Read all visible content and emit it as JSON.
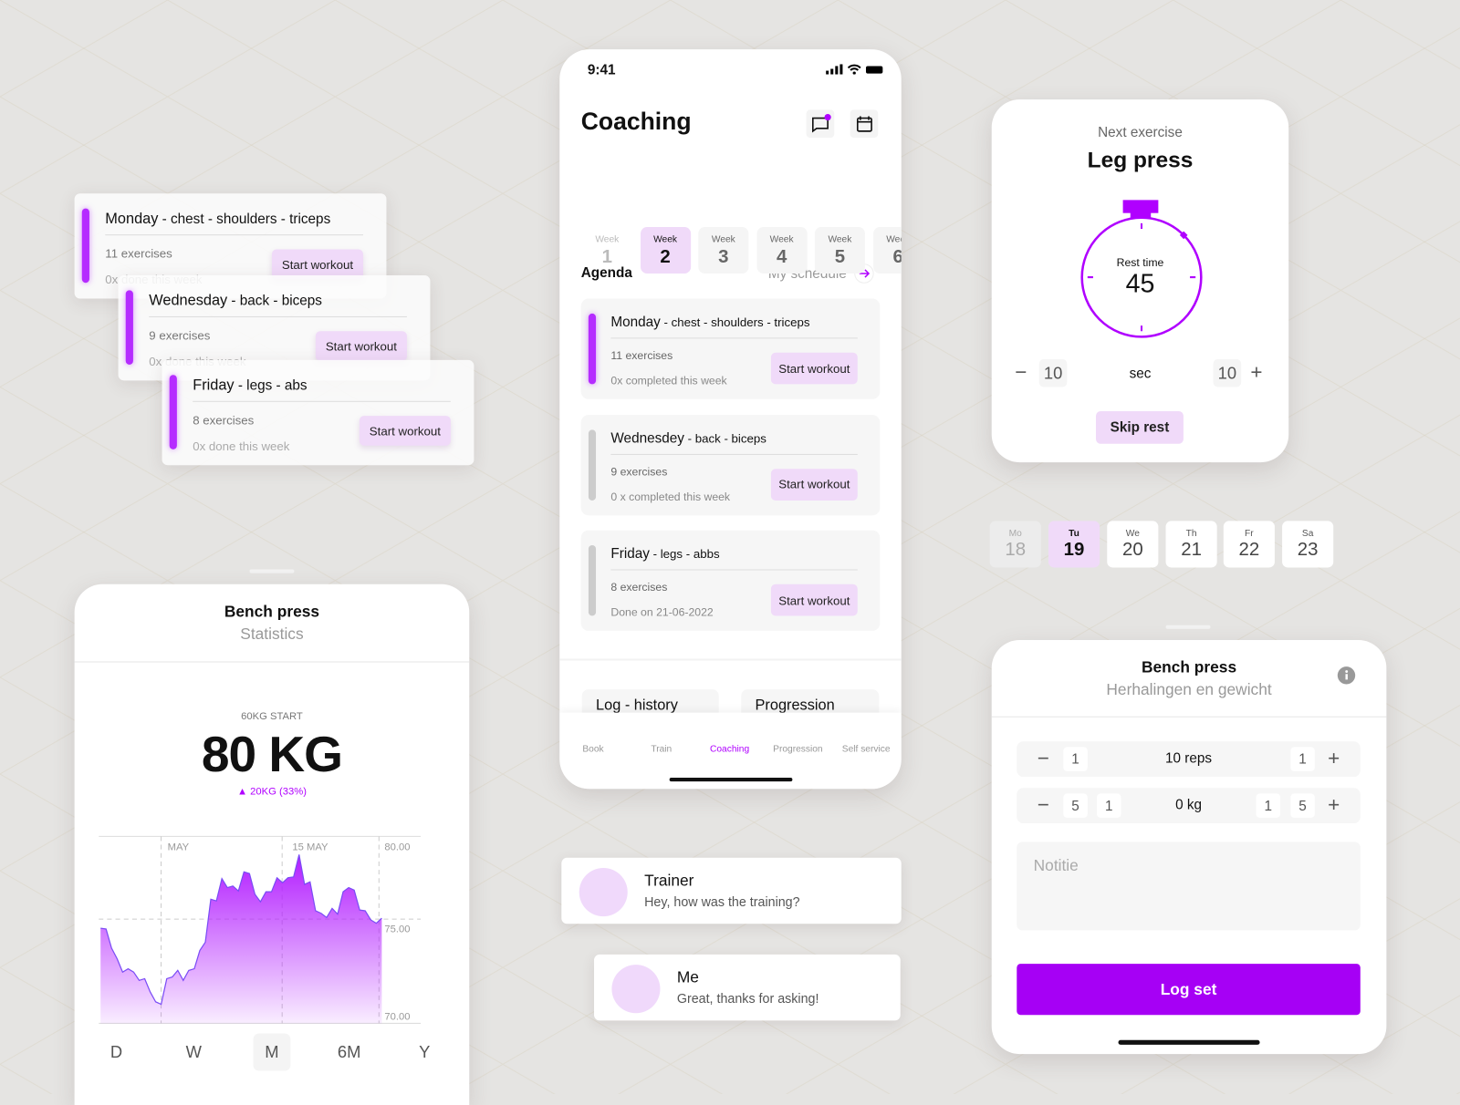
{
  "colors": {
    "accent": "#b000ff",
    "accent_light": "#f0daf9",
    "background": "#e5e4e2"
  },
  "stacked_cards": [
    {
      "day": "Monday",
      "muscles": " - chest - shoulders - triceps",
      "exercises": "11 exercises",
      "done": "0x done this week",
      "button": "Start workout"
    },
    {
      "day": "Wednesday",
      "muscles": " - back - biceps",
      "exercises": "9 exercises",
      "done": "0x done this week",
      "button": "Start workout"
    },
    {
      "day": "Friday",
      "muscles": " - legs - abs",
      "exercises": "8 exercises",
      "done": "0x done this week",
      "button": "Start workout"
    }
  ],
  "phone": {
    "status_time": "9:41",
    "title": "Coaching",
    "icons": [
      "chat-icon",
      "calendar-icon"
    ],
    "weeks": [
      {
        "label": "Week",
        "num": "1"
      },
      {
        "label": "Week",
        "num": "2",
        "selected": true
      },
      {
        "label": "Week",
        "num": "3"
      },
      {
        "label": "Week",
        "num": "4"
      },
      {
        "label": "Week",
        "num": "5"
      },
      {
        "label": "Week",
        "num": "6"
      }
    ],
    "agenda_title": "Agenda",
    "my_schedule": "My schedule",
    "agenda": [
      {
        "day": "Monday",
        "muscles": " - chest - shoulders - triceps",
        "exercises": "11 exercises",
        "done": "0x completed this week",
        "button": "Start workout",
        "active": true
      },
      {
        "day": "Wednesdey",
        "muscles": " - back - biceps",
        "exercises": "9 exercises",
        "done": "0 x completed this week",
        "button": "Start workout",
        "active": false
      },
      {
        "day": "Friday",
        "muscles": " - legs - abbs",
        "exercises": "8 exercises",
        "done": "Done on 21-06-2022",
        "button": "Start workout",
        "active": false
      }
    ],
    "sections": [
      "Log - history",
      "Progression"
    ],
    "tabs": [
      {
        "label": "Book",
        "icon": "book-icon"
      },
      {
        "label": "Train",
        "icon": "muscle-icon"
      },
      {
        "label": "Coaching",
        "icon": "whistle-icon",
        "active": true
      },
      {
        "label": "Progression",
        "icon": "bar-chart-icon"
      },
      {
        "label": "Self service",
        "icon": "grid-icon"
      }
    ]
  },
  "chats": [
    {
      "name": "Trainer",
      "message": "Hey, how was the training?"
    },
    {
      "name": "Me",
      "message": "Great, thanks for asking!"
    }
  ],
  "stats": {
    "title": "Bench press",
    "subtitle": "Statistics",
    "start": "60KG START",
    "current": "80 KG",
    "change": "20KG (33%)",
    "periods": [
      "D",
      "W",
      "M",
      "6M",
      "Y"
    ],
    "selected_period": "M"
  },
  "chart_data": {
    "type": "area",
    "x_ticks": [
      "MAY",
      "15 MAY"
    ],
    "y_ticks": [
      "80.00",
      "75.00",
      "70.00"
    ],
    "ylim": [
      68.7,
      80
    ],
    "series": [
      {
        "values": [
          74.45,
          74.4,
          73.25,
          72.6,
          71.8,
          72.0,
          71.8,
          71.3,
          71.4,
          70.6,
          70.0,
          69.85,
          71.4,
          71.5,
          71.9,
          71.3,
          71.9,
          72.0,
          73.1,
          73.6,
          76.2,
          76.1,
          77.45,
          76.9,
          77.0,
          76.7,
          77.85,
          77.75,
          76.5,
          76.05,
          76.65,
          76.65,
          77.5,
          77.2,
          77.5,
          77.55,
          78.9,
          77.1,
          77.25,
          75.5,
          75.35,
          75.1,
          75.65,
          75.3,
          76.65,
          76.9,
          76.75,
          75.55,
          75.5,
          74.95,
          74.75,
          75.05
        ]
      }
    ]
  },
  "timer": {
    "label": "Next exercise",
    "exercise": "Leg press",
    "rest_label": "Rest time",
    "rest_value": "45",
    "minus_step": "10",
    "unit": "sec",
    "plus_step": "10",
    "skip": "Skip rest",
    "progress_fraction": 0.125
  },
  "days": [
    {
      "l": "Mo",
      "n": "18"
    },
    {
      "l": "Tu",
      "n": "19",
      "selected": true
    },
    {
      "l": "We",
      "n": "20"
    },
    {
      "l": "Th",
      "n": "21"
    },
    {
      "l": "Fr",
      "n": "22"
    },
    {
      "l": "Sa",
      "n": "23"
    }
  ],
  "logset": {
    "title": "Bench press",
    "subtitle": "Herhalingen en gewicht",
    "reps": {
      "minus": [
        "1"
      ],
      "value": "10 reps",
      "plus": [
        "1"
      ]
    },
    "weight": {
      "minus": [
        "5",
        "1"
      ],
      "value": "0 kg",
      "plus": [
        "1",
        "5"
      ]
    },
    "note_placeholder": "Notitie",
    "button": "Log set"
  }
}
